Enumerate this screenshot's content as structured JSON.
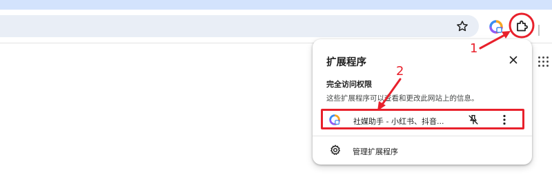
{
  "browser": {
    "toolbar": {
      "bookmark_icon": "star-icon",
      "extension_chip_icon": "colorful-ring-icon",
      "extensions_button_icon": "puzzle-icon"
    }
  },
  "extensions_panel": {
    "title": "扩展程序",
    "close_icon": "close-icon",
    "section_title": "完全访问权限",
    "section_description": "这些扩展程序可以查看和更改此网站上的信息。",
    "extensions": [
      {
        "name": "社媒助手 - 小红书、抖音...",
        "icon": "colorful-ring-icon",
        "pin_icon": "pin-off-icon",
        "menu_icon": "more-vert-icon"
      }
    ],
    "manage_label": "管理扩展程序",
    "manage_icon": "gear-icon"
  },
  "annotations": {
    "step1": "1",
    "step2": "2",
    "color": "#e8202b"
  },
  "colors": {
    "accent_strip": "#d3e3fd",
    "omnibox": "#e9eef6"
  }
}
